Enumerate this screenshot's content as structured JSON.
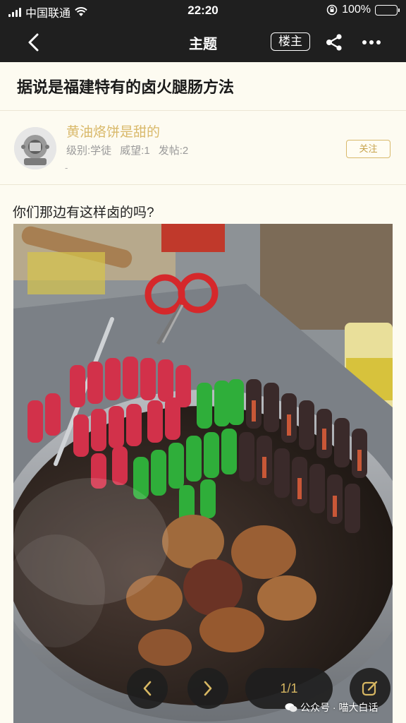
{
  "status_bar": {
    "carrier": "中国联通",
    "time": "22:20",
    "battery": "100%",
    "battery_level": 1.0
  },
  "nav": {
    "title": "主题",
    "owner_label": "楼主",
    "back_icon": "chevron-left-icon",
    "share_icon": "share-icon",
    "more_icon": "more-dots-icon"
  },
  "post": {
    "title": "据说是福建特有的卤火腿肠方法",
    "author": {
      "name": "黄油烙饼是甜的",
      "level": "级别:学徒",
      "prestige": "威望:1",
      "posts": "发帖:2",
      "extra": "-"
    },
    "follow_label": "关注",
    "text": "你们那边有这样卤的吗?"
  },
  "controls": {
    "pager": "1/1",
    "prev_icon": "chevron-left-icon",
    "next_icon": "chevron-right-icon",
    "edit_icon": "edit-icon"
  },
  "watermark": "公众号 · 喵大白话",
  "colors": {
    "accent": "#d7b762",
    "dark_bar": "#1f1f1f",
    "page_bg": "#fdfbf1"
  }
}
